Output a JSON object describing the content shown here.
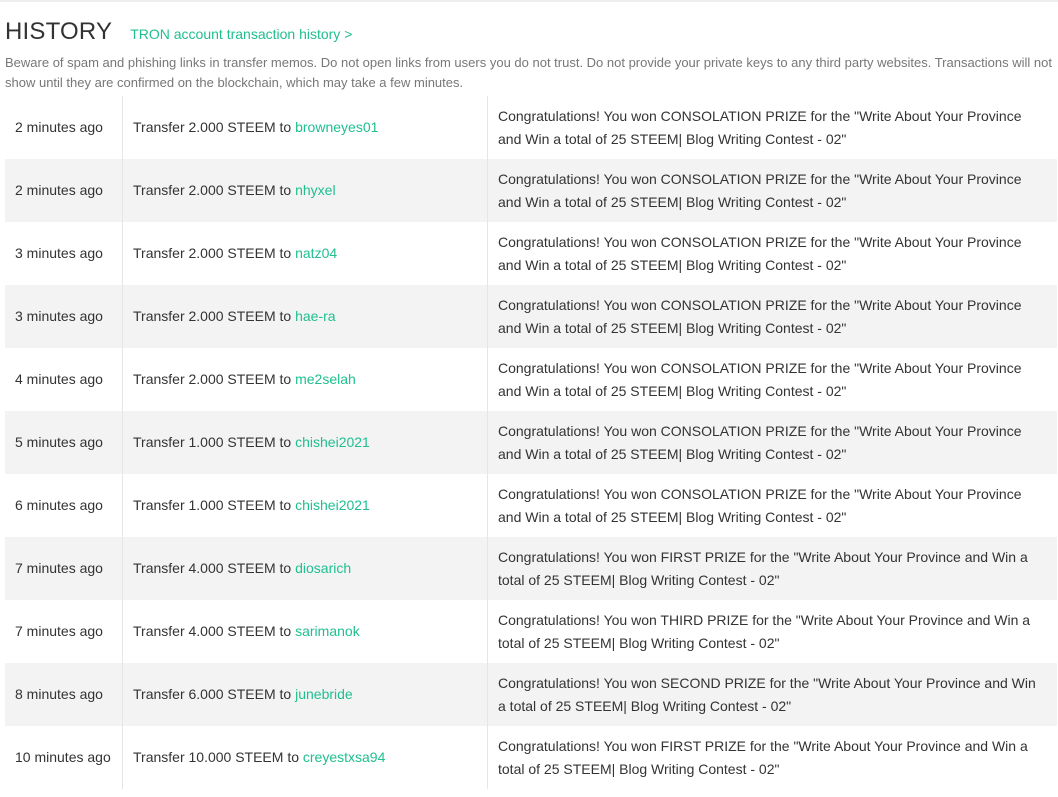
{
  "header": {
    "title": "HISTORY",
    "tron_link": "TRON account transaction history >"
  },
  "warning": "Beware of spam and phishing links in transfer memos. Do not open links from users you do not trust. Do not provide your private keys to any third party websites. Transactions will not show until they are confirmed on the blockchain, which may take a few minutes.",
  "rows": [
    {
      "time": "2 minutes ago",
      "op": "Transfer 2.000 STEEM to ",
      "to": "browneyes01",
      "memo": "Congratulations! You won CONSOLATION PRIZE for the \"Write About Your Province and Win a total of 25 STEEM| Blog Writing Contest - 02\""
    },
    {
      "time": "2 minutes ago",
      "op": "Transfer 2.000 STEEM to ",
      "to": "nhyxel",
      "memo": "Congratulations! You won CONSOLATION PRIZE for the \"Write About Your Province and Win a total of 25 STEEM| Blog Writing Contest - 02\""
    },
    {
      "time": "3 minutes ago",
      "op": "Transfer 2.000 STEEM to ",
      "to": "natz04",
      "memo": "Congratulations! You won CONSOLATION PRIZE for the \"Write About Your Province and Win a total of 25 STEEM| Blog Writing Contest - 02\""
    },
    {
      "time": "3 minutes ago",
      "op": "Transfer 2.000 STEEM to ",
      "to": "hae-ra",
      "memo": "Congratulations! You won CONSOLATION PRIZE for the \"Write About Your Province and Win a total of 25 STEEM| Blog Writing Contest - 02\""
    },
    {
      "time": "4 minutes ago",
      "op": "Transfer 2.000 STEEM to ",
      "to": "me2selah",
      "memo": "Congratulations! You won CONSOLATION PRIZE for the \"Write About Your Province and Win a total of 25 STEEM| Blog Writing Contest - 02\""
    },
    {
      "time": "5 minutes ago",
      "op": "Transfer 1.000 STEEM to ",
      "to": "chishei2021",
      "memo": "Congratulations! You won CONSOLATION PRIZE for the \"Write About Your Province and Win a total of 25 STEEM| Blog Writing Contest - 02\""
    },
    {
      "time": "6 minutes ago",
      "op": "Transfer 1.000 STEEM to ",
      "to": "chishei2021",
      "memo": "Congratulations! You won CONSOLATION PRIZE for the \"Write About Your Province and Win a total of 25 STEEM| Blog Writing Contest - 02\""
    },
    {
      "time": "7 minutes ago",
      "op": "Transfer 4.000 STEEM to ",
      "to": "diosarich",
      "memo": "Congratulations! You won FIRST PRIZE for the \"Write About Your Province and Win a total of 25 STEEM| Blog Writing Contest - 02\""
    },
    {
      "time": "7 minutes ago",
      "op": "Transfer 4.000 STEEM to ",
      "to": "sarimanok",
      "memo": "Congratulations! You won THIRD PRIZE for the \"Write About Your Province and Win a total of 25 STEEM| Blog Writing Contest - 02\""
    },
    {
      "time": "8 minutes ago",
      "op": "Transfer 6.000 STEEM to ",
      "to": "junebride",
      "memo": "Congratulations! You won SECOND PRIZE for the \"Write About Your Province and Win a total of 25 STEEM| Blog Writing Contest - 02\""
    },
    {
      "time": "10 minutes ago",
      "op": "Transfer 10.000 STEEM to ",
      "to": "creyestxsa94",
      "memo": "Congratulations! You won FIRST PRIZE for the \"Write About Your Province and Win a total of 25 STEEM| Blog Writing Contest - 02\""
    }
  ],
  "colors": {
    "link": "#1fbf8f",
    "stripe": "#f3f3f3",
    "text": "#333333",
    "muted": "#777777"
  }
}
